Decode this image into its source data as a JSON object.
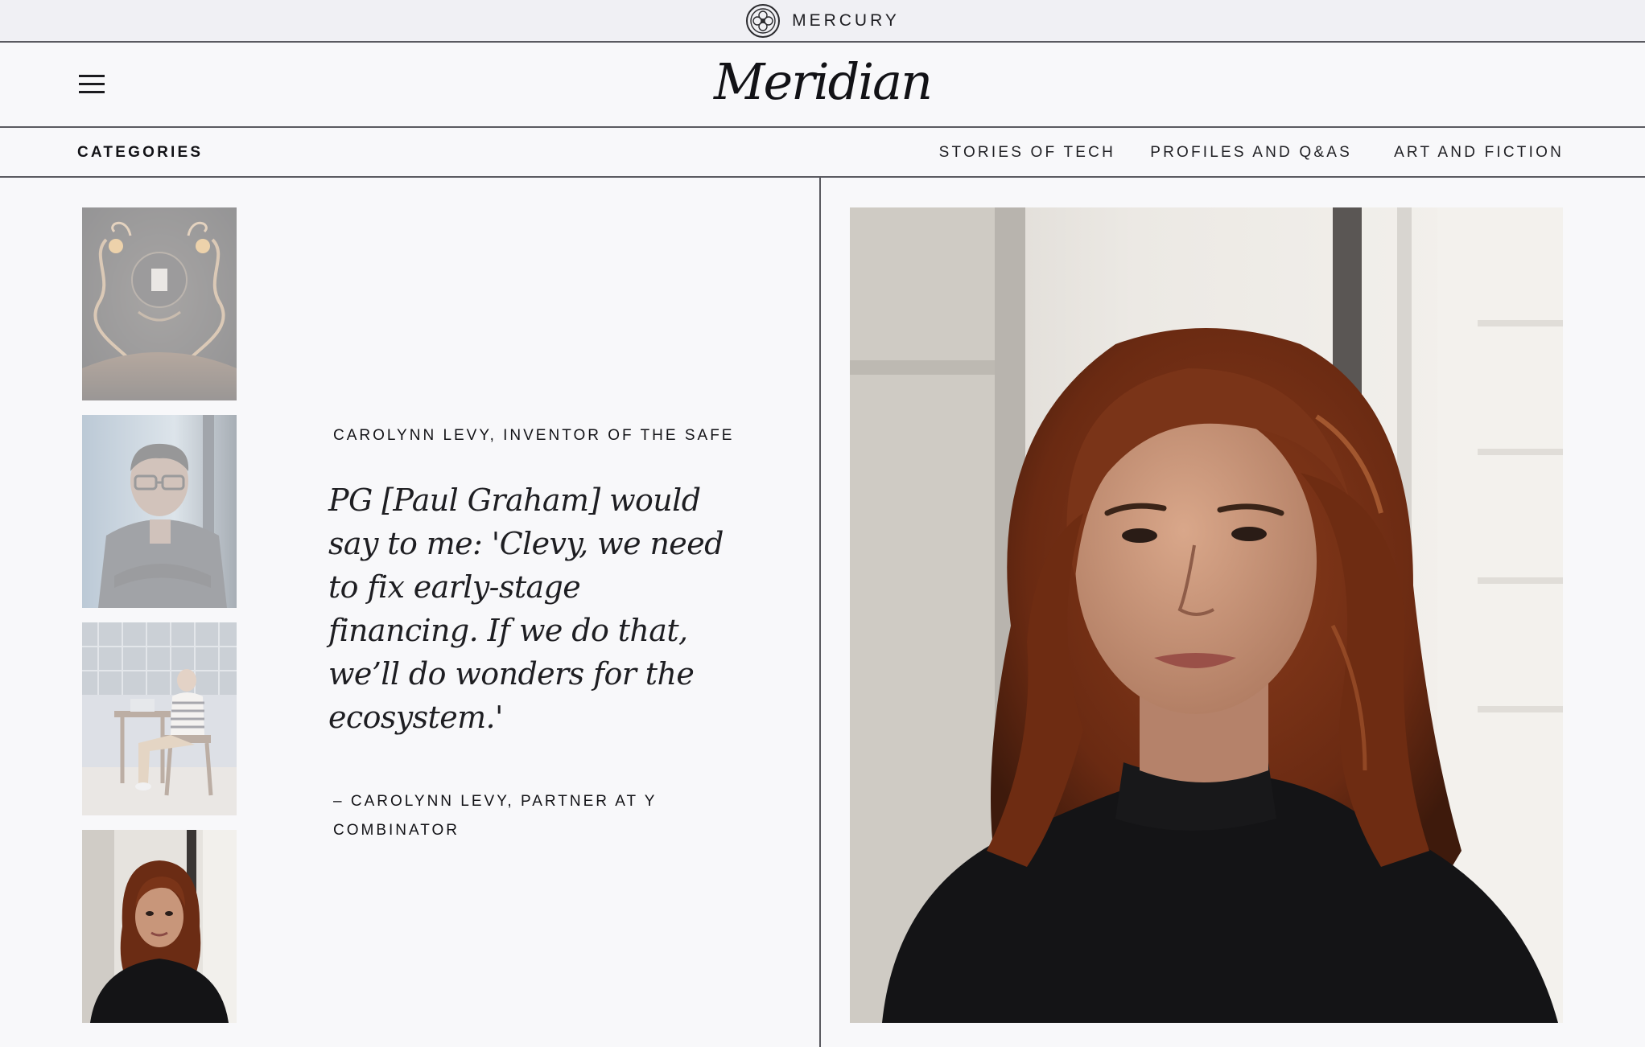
{
  "brand": {
    "name": "MERCURY",
    "logo_icon": "mercury-emblem-icon"
  },
  "masthead": {
    "menu_icon": "hamburger-menu-icon",
    "title": "Meridian"
  },
  "nav": {
    "categories_label": "CATEGORIES",
    "links": [
      {
        "label": "STORIES OF TECH"
      },
      {
        "label": "PROFILES AND Q&AS"
      },
      {
        "label": "ART AND FICTION"
      }
    ]
  },
  "thumbnails": [
    {
      "subject": "ornate dark artwork",
      "active": false
    },
    {
      "subject": "man with glasses, arms crossed",
      "active": false
    },
    {
      "subject": "person seated at desk with laptop",
      "active": false
    },
    {
      "subject": "woman with long auburn hair",
      "active": true
    }
  ],
  "feature": {
    "eyebrow": "CAROLYNN LEVY, INVENTOR OF THE SAFE",
    "quote": "PG [Paul Graham] would say to me: 'Clevy, we need to fix early-stage financing. If we do that, we’ll do wonders for the ecosystem.'",
    "attribution": "– CAROLYNN LEVY, PARTNER AT Y COMBINATOR"
  },
  "hero": {
    "subject": "portrait of woman with long auburn hair in black sweater"
  },
  "colors": {
    "background": "#f8f8fa",
    "brand_bar": "#f0f0f4",
    "rule": "#5a5a60",
    "text": "#1b1b1f",
    "hair": "#7a3418",
    "sweater": "#141416"
  }
}
